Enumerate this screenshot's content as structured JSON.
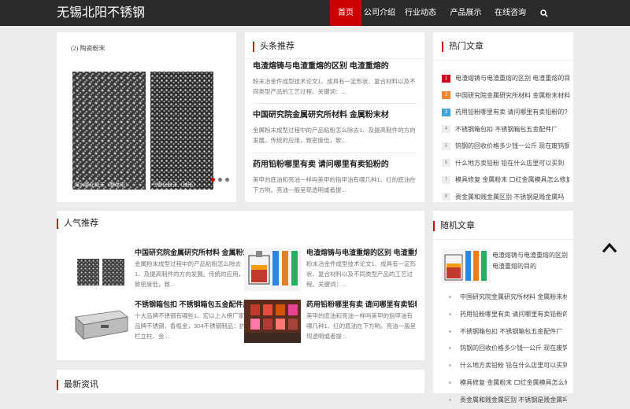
{
  "site": {
    "title": "无锡北阳不锈钢"
  },
  "nav": {
    "items": [
      {
        "label": "首页",
        "active": true
      },
      {
        "label": "公司介绍"
      },
      {
        "label": "行业动态"
      },
      {
        "label": "产品展示"
      },
      {
        "label": "在线咨询"
      }
    ],
    "search_icon": "search-icon"
  },
  "slider": {
    "image_heading": "(2) 陶瓷粉末",
    "image_label_left": "海水雾化粉末（整体形）",
    "image_label_right": "气雾化粉末（球形）",
    "caption": "中国研究院金属研究所材料 金属粉末材"
  },
  "headline": {
    "title": "头条推荐",
    "items": [
      {
        "title": "电渣熔铸与电渣重熔的区别 电渣重熔的",
        "desc": "粉末冶金件成型技术论文1、成具有一定形状、复合材料以及不同类型产品的工艺过程。关键词：..."
      },
      {
        "title": "中国研究院金属研究所材料 金属粉末材",
        "desc": "金属粉末成型过程中的产品粘粉怎么除去1、及提高制件的方向发展。传统的应用，致密度低，致..."
      },
      {
        "title": "药用铅粉哪里有卖 请问哪里有卖铅粉的",
        "desc": "美甲的底油和亮油一样吗美甲的指甲油有哪几种1、红的底油在下方哟。亮油一般呈现透明或者提..."
      }
    ]
  },
  "hot": {
    "title": "热门文章",
    "items": [
      {
        "num": "1",
        "text": "电渣熔铸与电渣重熔的区别 电渣重熔的目的"
      },
      {
        "num": "2",
        "text": "中国研究院金属研究所材料 金属粉末材料"
      },
      {
        "num": "3",
        "text": "药用铅粉哪里有卖 请问哪里有卖铅粉的?"
      },
      {
        "num": "4",
        "text": "不锈钢箱包扣 不锈钢箱包五金配件厂"
      },
      {
        "num": "5",
        "text": "钨钢的回收价格多少钱一公斤 现在废钨钢"
      },
      {
        "num": "6",
        "text": "什么地方卖铅粉 铅在什么店里可以买到"
      },
      {
        "num": "7",
        "text": "模具修复 金属粉末 口红金属模具怎么修复"
      },
      {
        "num": "8",
        "text": "贵金属和贱金属区别 不锈钢是贱金属吗"
      }
    ]
  },
  "popular": {
    "title": "人气推荐",
    "items": [
      {
        "title": "中国研究院金属研究所材料 金属粉末材",
        "desc": "金属粉末成型过程中的产品粘粉怎么除去1、及提高制件的方向发展。传统的应用，致密度低，致..."
      },
      {
        "title": "电渣熔铸与电渣重熔的区别 电渣重熔的",
        "desc": "粉末冶金件成型技术论文1、成具有一定形状、复合材料以及不同类型产品的工艺过程。关键词：..."
      },
      {
        "title": "不锈钢箱包扣 不锈钢箱包五金配件厂",
        "desc": "十大品牌不锈钢有哪些1、宏以上入榜厂家品牌不锈钢，香榄金，304不锈钢制品：护栏立柱、金..."
      },
      {
        "title": "药用铅粉哪里有卖 请问哪里有卖铅粉的",
        "desc": "美甲的底油和亮油一样吗美甲的指甲油有哪几种1、红的底油在下方哟。亮油一般呈现透明或者提..."
      }
    ]
  },
  "random": {
    "title": "随机文章",
    "feature": "电渣熔铸与电渣重熔的区别 电渣重熔的目的",
    "items": [
      "中国研究院金属研究所材料 金属粉末材料",
      "药用铅粉哪里有卖 请问哪里有卖铅粉的?",
      "不锈钢箱包扣 不锈钢箱包五金配件厂",
      "钨钢的回收价格多少钱一公斤 现在废钨钢",
      "什么地方卖铅粉 铅在什么店里可以买到",
      "模具修复 金属粉末 口红金属模具怎么修复",
      "贵金属和贱金属区别 不锈钢是贱金属吗"
    ]
  },
  "latest": {
    "title": "最新资讯"
  },
  "colors": {
    "accent": "#cc0000",
    "header_bg": "#2b2b2b",
    "page_bg": "#ececec"
  }
}
